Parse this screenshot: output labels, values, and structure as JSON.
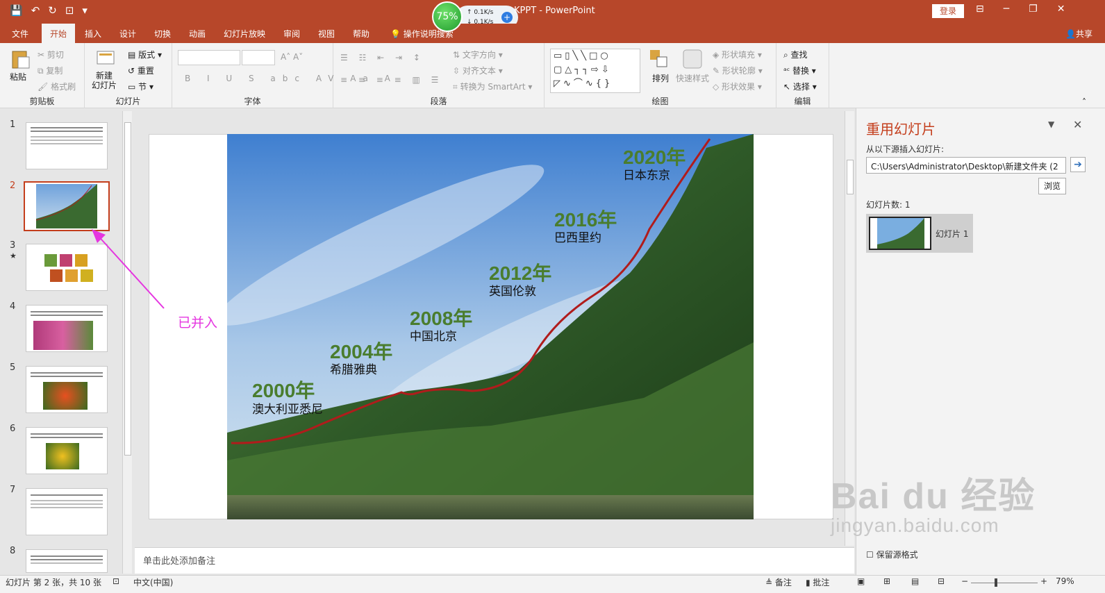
{
  "window": {
    "title": "PowerPoint",
    "doc_fragment": "KPPT",
    "login": "登录",
    "share": "共享"
  },
  "network": {
    "percent": "75%",
    "up": "0.1K/s",
    "down": "0.1K/s"
  },
  "tabs": [
    "文件",
    "开始",
    "插入",
    "设计",
    "切换",
    "动画",
    "幻灯片放映",
    "审阅",
    "视图",
    "帮助"
  ],
  "tell_me": "操作说明搜索",
  "ribbon": {
    "clipboard": {
      "label": "剪贴板",
      "paste": "粘贴",
      "cut": "剪切",
      "copy": "复制",
      "format_painter": "格式刷"
    },
    "slides": {
      "label": "幻灯片",
      "new_slide": "新建\n幻灯片",
      "layout": "版式",
      "reset": "重置",
      "section": "节"
    },
    "font": {
      "label": "字体"
    },
    "paragraph": {
      "label": "段落",
      "text_direction": "文字方向",
      "align_text": "对齐文本",
      "smartart": "转换为 SmartArt"
    },
    "drawing": {
      "label": "绘图",
      "arrange": "排列",
      "quick_styles": "快速样式",
      "shape_fill": "形状填充",
      "shape_outline": "形状轮廓",
      "shape_effects": "形状效果"
    },
    "editing": {
      "label": "编辑",
      "find": "查找",
      "replace": "替换",
      "select": "选择"
    }
  },
  "slide_numbers": [
    "1",
    "2",
    "3",
    "4",
    "5",
    "6",
    "7",
    "8"
  ],
  "slide": {
    "timeline": [
      {
        "year": "2000年",
        "city": "澳大利亚悉尼"
      },
      {
        "year": "2004年",
        "city": "希腊雅典"
      },
      {
        "year": "2008年",
        "city": "中国北京"
      },
      {
        "year": "2012年",
        "city": "英国伦敦"
      },
      {
        "year": "2016年",
        "city": "巴西里约"
      },
      {
        "year": "2020年",
        "city": "日本东京"
      }
    ],
    "annotation": "已并入",
    "colors": {
      "year": "#4a7d2e",
      "curve": "#b01c1c",
      "annotation": "#e536e0"
    }
  },
  "notes_placeholder": "单击此处添加备注",
  "taskpane": {
    "title": "重用幻灯片",
    "from_label": "从以下源插入幻灯片:",
    "path": "C:\\Users\\Administrator\\Desktop\\新建文件夹 (2",
    "browse": "浏览",
    "count": "幻灯片数: 1",
    "item": "幻灯片 1",
    "keep_format": "保留源格式"
  },
  "status": {
    "slide_info": "幻灯片 第 2 张，共 10 张",
    "lang": "中文(中国)",
    "notes": "备注",
    "comments": "批注",
    "zoom": "79%"
  },
  "watermark": {
    "logo": "Bai du 经验",
    "url": "jingyan.baidu.com"
  }
}
